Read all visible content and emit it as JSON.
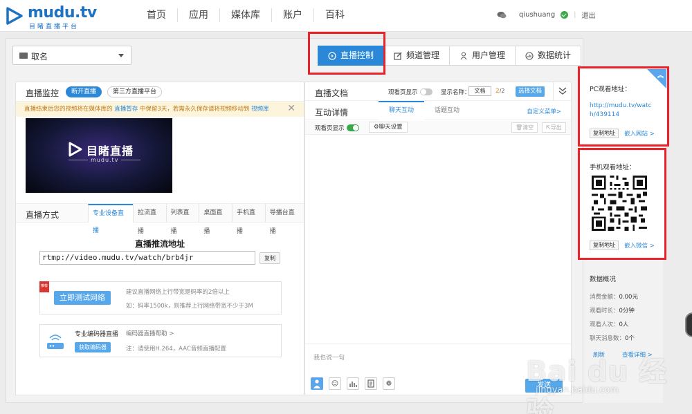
{
  "app": {
    "logo_text": "mudu.tv",
    "logo_sub": "目睹直播平台"
  },
  "nav": {
    "items": [
      "首页",
      "应用",
      "媒体库",
      "账户",
      "百科"
    ]
  },
  "user": {
    "name": "qiushuang",
    "logout": "退出"
  },
  "channel_select": {
    "value": "取名"
  },
  "main_tabs": [
    {
      "label": "直播控制",
      "icon": "play-circle-icon",
      "active": true
    },
    {
      "label": "频道管理",
      "icon": "edit-icon",
      "active": false
    },
    {
      "label": "用户管理",
      "icon": "user-icon",
      "active": false
    },
    {
      "label": "数据统计",
      "icon": "chart-icon",
      "active": false
    }
  ],
  "monitor": {
    "title": "直播监控",
    "stop_btn": "断开直播",
    "third_party_btn": "第三方直播平台",
    "notice_text": "直播结束后您的视频将在媒体库的 ",
    "notice_link1": "直播暂存",
    "notice_text2": " 中保留3天，若需永久保存请将视频移动到 ",
    "notice_link2": "视频库",
    "video_title": "目睹直播",
    "video_sub": "mudu.tv"
  },
  "mode": {
    "title": "直播方式",
    "tabs": [
      "专业设备直播",
      "拉流直播",
      "列表直播",
      "桌面直播",
      "手机直播",
      "导播台直播"
    ]
  },
  "push": {
    "title": "直播推流地址",
    "url": "rtmp://video.mudu.tv/watch/brb4jr",
    "copy": "复制"
  },
  "network": {
    "badge": "推荐",
    "button": "立即测试网络",
    "tip1": "建议直播网络上行带宽是码率的2倍以上",
    "tip2": "如：码率1500k，则推荐上行网络带宽不少于3M"
  },
  "encoder": {
    "title": "专业编码器直播",
    "button": "获取编码器",
    "help": "编码器直播帮助 >",
    "note": "注：请使用H.264，AAC音频直播配置"
  },
  "doc": {
    "title": "直播文档",
    "viewer_show": "观看页显示",
    "display_name_label": "显示名称：",
    "display_name_value": "文档",
    "page_current": "2",
    "page_total": "/2",
    "choose_btn": "选择文档"
  },
  "interact": {
    "title": "互动详情",
    "tabs": [
      "聊天互动",
      "话题互动"
    ],
    "custom_menu": "自定义菜单>",
    "viewer_show": "观看页显示",
    "chat_settings": "聊天设置",
    "clear": "清空",
    "export": "导出",
    "placeholder": "我也说一句",
    "send": "发送"
  },
  "pc_watch": {
    "title": "PC观看地址：",
    "url": "http://mudu.tv/watch/439114",
    "copy": "复制地址",
    "embed": "嵌入网站 >"
  },
  "mobile_watch": {
    "title": "手机观看地址：",
    "copy": "复制地址",
    "embed": "嵌入微信 >"
  },
  "stats": {
    "title": "数据概况",
    "items": [
      {
        "label": "消费金额：",
        "value": "0.00元"
      },
      {
        "label": "观看时长：",
        "value": "0分钟"
      },
      {
        "label": "观看人次：",
        "value": "0人"
      },
      {
        "label": "聊天消息数：",
        "value": "0个"
      }
    ],
    "refresh": "刷新",
    "detail": "查看详细 >"
  },
  "watermark": {
    "main": "Bai du 经验",
    "sub": "jingyan.baidu.com"
  },
  "colors": {
    "accent": "#2b88d8",
    "highlight_box": "#e8232a",
    "notice_bg": "#fdf4dc"
  }
}
